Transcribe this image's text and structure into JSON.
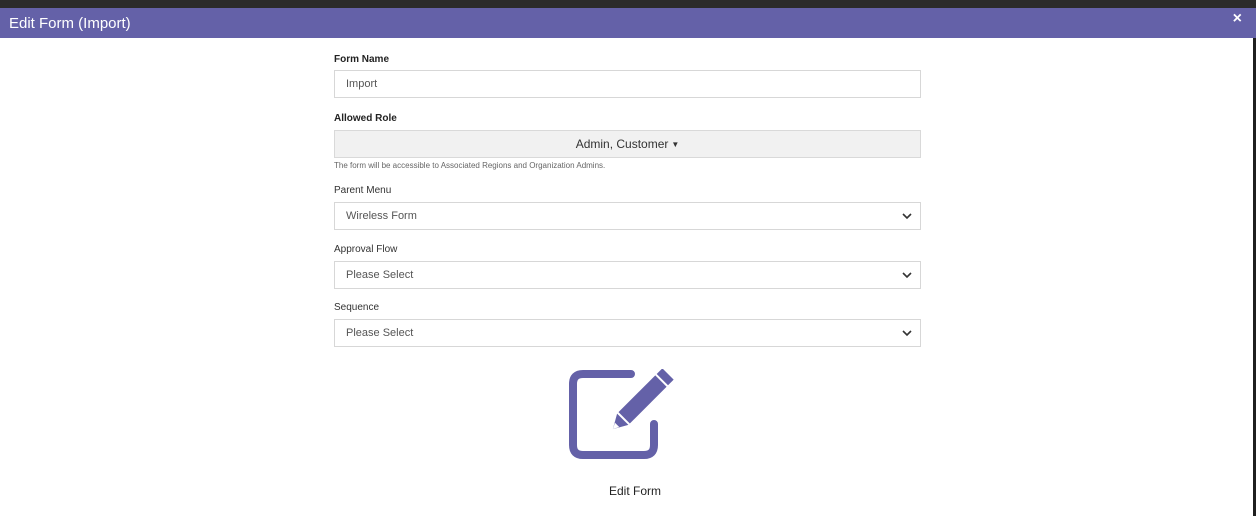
{
  "dialog": {
    "title": "Edit Form (Import)",
    "close": "×"
  },
  "form": {
    "form_name_label": "Form Name",
    "form_name_value": "Import",
    "allowed_role_label": "Allowed Role",
    "allowed_role_value": "Admin, Customer",
    "allowed_role_hint": "The form will be accessible to Associated Regions and Organization Admins.",
    "parent_menu_label": "Parent Menu",
    "parent_menu_value": "Wireless Form",
    "approval_flow_label": "Approval Flow",
    "approval_flow_value": "Please Select",
    "sequence_label": "Sequence",
    "sequence_value": "Please Select"
  },
  "edit_form": {
    "label": "Edit Form",
    "icon": "edit-form-icon"
  },
  "colors": {
    "accent": "#6461a8"
  }
}
